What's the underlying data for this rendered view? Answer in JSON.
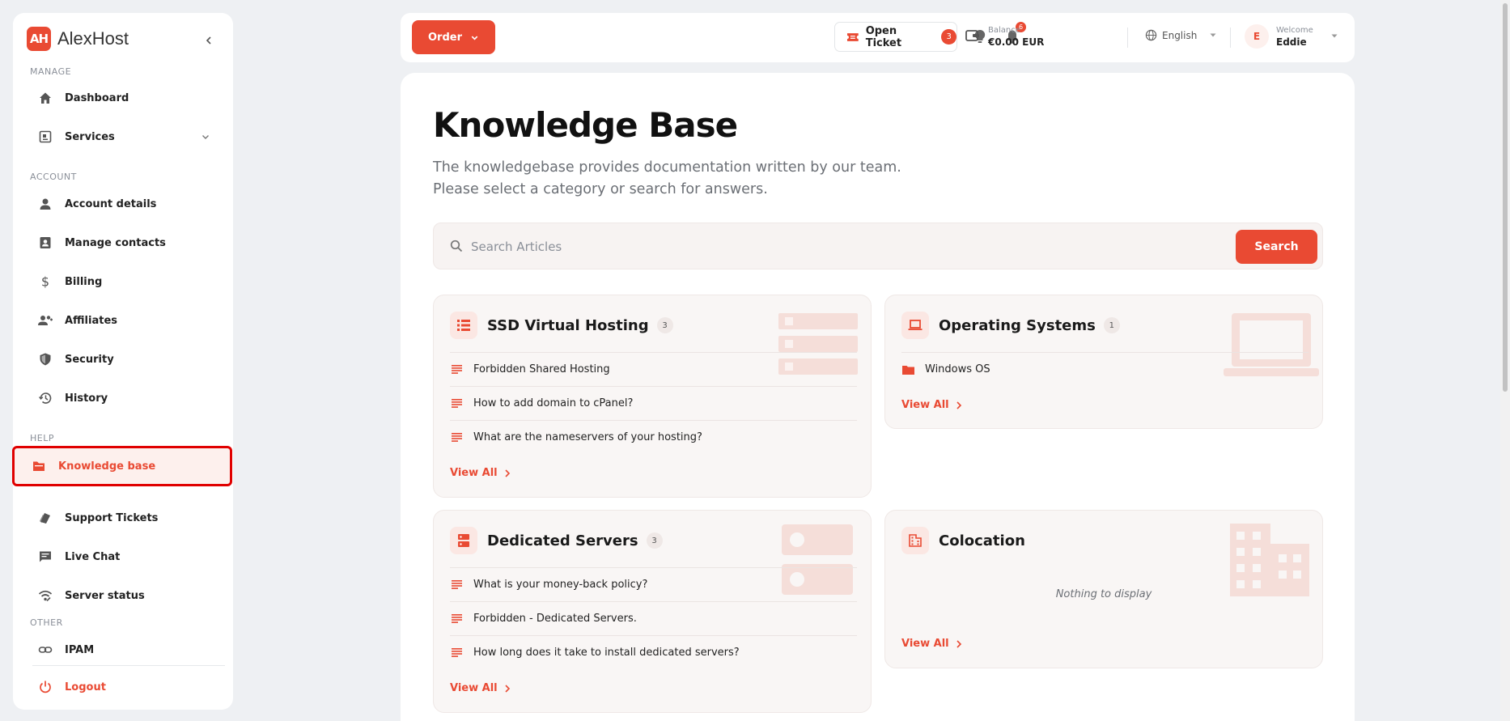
{
  "brand": {
    "logo_text": "AH",
    "name": "AlexHost"
  },
  "sidebar": {
    "sections": {
      "manage": "MANAGE",
      "account": "ACCOUNT",
      "help": "HELP",
      "other": "OTHER"
    },
    "items": [
      {
        "label": "Dashboard",
        "icon": "home-icon"
      },
      {
        "label": "Services",
        "icon": "services-icon"
      },
      {
        "label": "Account details",
        "icon": "person-icon"
      },
      {
        "label": "Manage contacts",
        "icon": "contacts-icon"
      },
      {
        "label": "Billing",
        "icon": "dollar-icon"
      },
      {
        "label": "Affiliates",
        "icon": "affiliates-icon"
      },
      {
        "label": "Security",
        "icon": "shield-icon"
      },
      {
        "label": "History",
        "icon": "history-icon"
      },
      {
        "label": "Knowledge base",
        "icon": "book-icon"
      },
      {
        "label": "Support Tickets",
        "icon": "ticket-icon"
      },
      {
        "label": "Live Chat",
        "icon": "chat-icon"
      },
      {
        "label": "Server status",
        "icon": "signal-icon"
      },
      {
        "label": "IPAM",
        "icon": "link-icon"
      },
      {
        "label": "Logout",
        "icon": "power-icon"
      }
    ]
  },
  "topbar": {
    "order_label": "Order",
    "ticket_label": "Open Ticket",
    "ticket_count": "3",
    "notification_count": "6",
    "balance_label": "Balance",
    "balance_value": "€0.00 EUR",
    "language": "English",
    "welcome": "Welcome",
    "user_name": "Eddie",
    "user_initial": "E"
  },
  "main": {
    "title": "Knowledge Base",
    "description": "The knowledgebase provides documentation written by our team. Please select a category or search for answers.",
    "search_placeholder": "Search Articles",
    "search_button": "Search",
    "view_all": "View All",
    "empty_text": "Nothing to display",
    "categories": [
      {
        "title": "SSD Virtual Hosting",
        "count": "3",
        "articles": [
          "Forbidden Shared Hosting",
          "How to add domain to cPanel?",
          "What are the nameservers of your hosting?"
        ]
      },
      {
        "title": "Operating Systems",
        "count": "1",
        "articles": [
          "Windows OS"
        ]
      },
      {
        "title": "Dedicated Servers",
        "count": "3",
        "articles": [
          "What is your money-back policy?",
          "Forbidden - Dedicated Servers.",
          "How long does it take to install dedicated servers?"
        ]
      },
      {
        "title": "Colocation",
        "count": "",
        "articles": []
      }
    ]
  },
  "colors": {
    "accent": "#e94a33",
    "highlight_border": "#e00000",
    "card_bg": "#f9f6f5"
  }
}
